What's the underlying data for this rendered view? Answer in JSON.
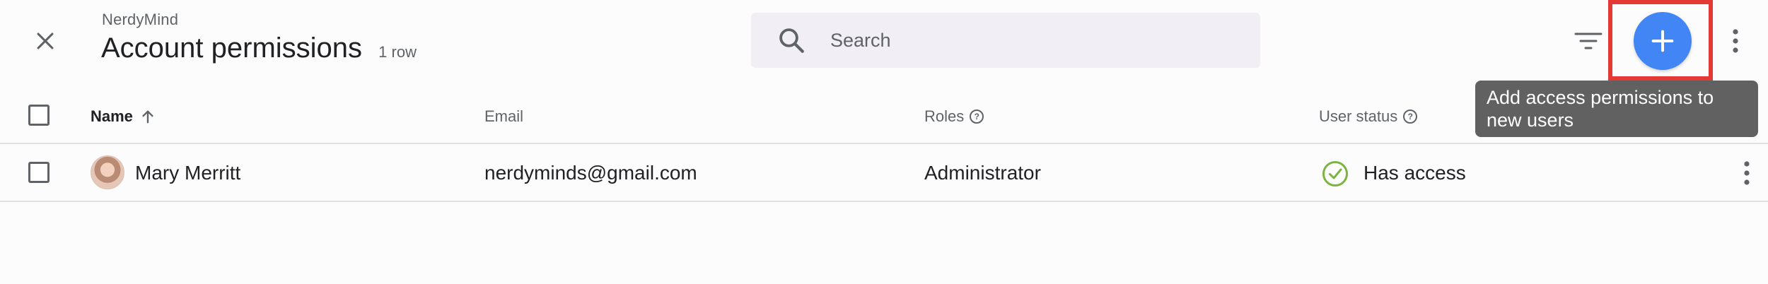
{
  "header": {
    "org_name": "NerdyMind",
    "title": "Account permissions",
    "row_count": "1 row",
    "close_icon": "close-icon",
    "filter_icon": "filter-icon",
    "add_icon": "plus-icon",
    "more_icon": "more-vert-icon",
    "accent_color": "#4285f4",
    "highlight_color": "#e53935"
  },
  "search": {
    "placeholder": "Search",
    "value": ""
  },
  "tooltip": {
    "text": "Add access permissions to new users"
  },
  "table": {
    "columns": [
      {
        "label": "Name",
        "sort": "ascending"
      },
      {
        "label": "Email"
      },
      {
        "label": "Roles",
        "help": true
      },
      {
        "label": "User status",
        "help": true
      }
    ],
    "rows": [
      {
        "name": "Mary Merritt",
        "email": "nerdyminds@gmail.com",
        "role": "Administrator",
        "status": "Has access",
        "status_color": "#7cb342"
      }
    ]
  }
}
